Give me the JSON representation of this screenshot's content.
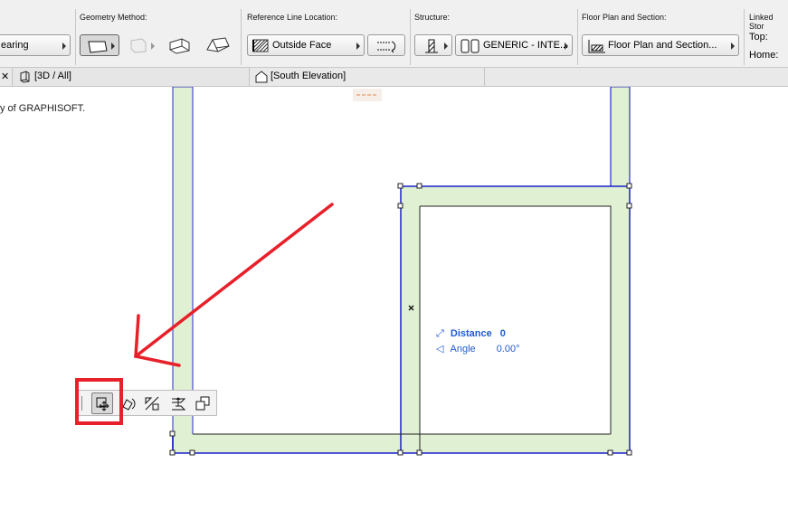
{
  "toolbar": {
    "groups": {
      "geometry_method": "Geometry Method:",
      "reference_line_location": "Reference Line Location:",
      "structure": "Structure:",
      "floor_plan_and_section": "Floor Plan and Section:",
      "linked_stories": "Linked Stor"
    },
    "bearing_label": "earing",
    "reference_line_value": "Outside Face",
    "structure_value": "GENERIC - INTE...",
    "floor_plan_value": "Floor Plan and Section...",
    "linked_top": "Top:",
    "linked_home": "Home:"
  },
  "tabs": [
    {
      "label": "[3D / All]"
    },
    {
      "label": "[South Elevation]"
    }
  ],
  "canvas": {
    "copyright_text": "y of GRAPHISOFT."
  },
  "tracker": {
    "distance_label": "Distance",
    "distance_value": "0",
    "angle_label": "Angle",
    "angle_value": "0.00°"
  },
  "pet_palette": {
    "items": [
      "move-icon",
      "rotate-icon",
      "mirror-icon",
      "elevate-icon",
      "multiply-icon"
    ]
  },
  "colors": {
    "wall_fill": "#dff0d3",
    "selection_blue": "#1a1fc9",
    "annotation_red": "#e8202a",
    "tracker_blue": "#1f5bd6"
  }
}
